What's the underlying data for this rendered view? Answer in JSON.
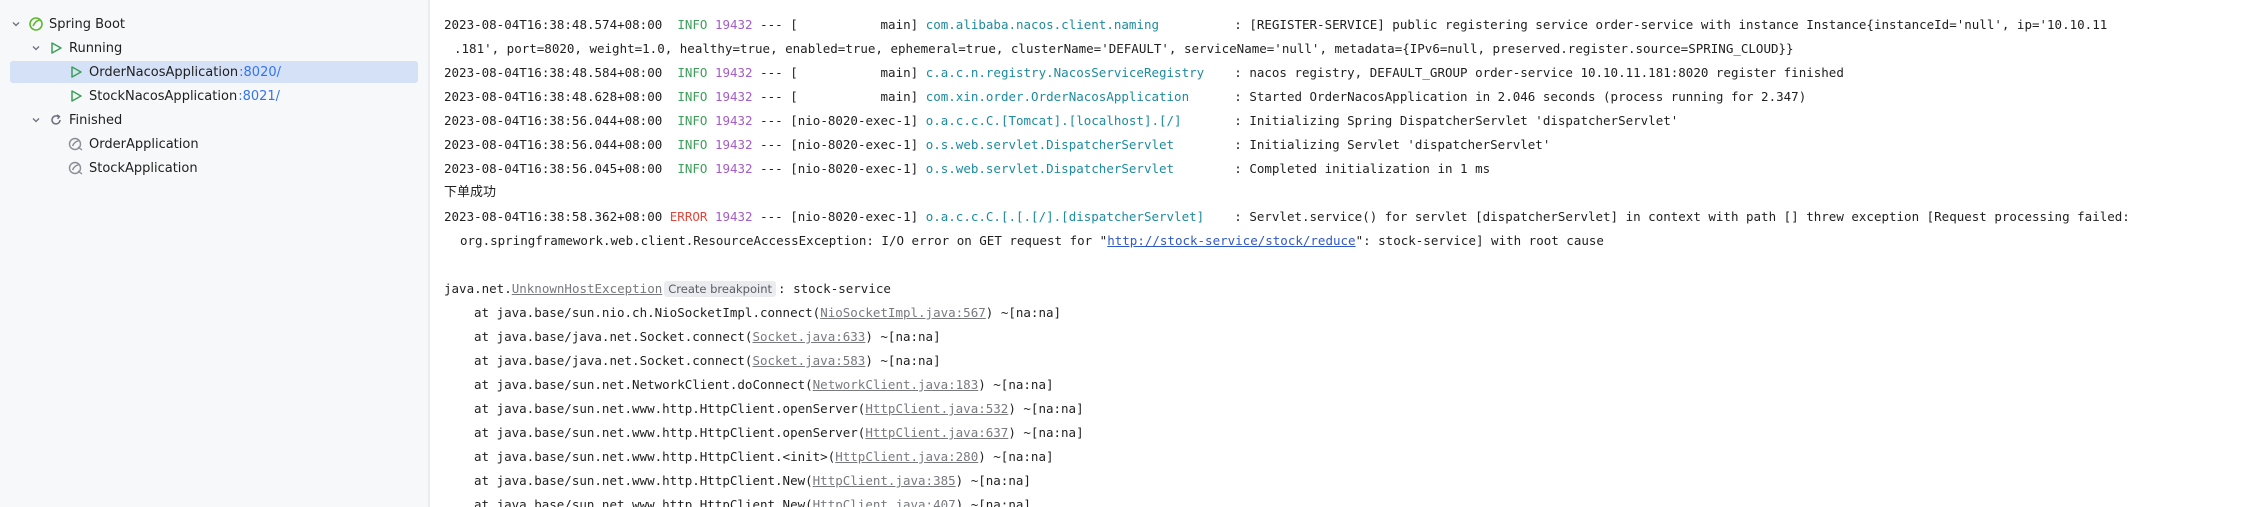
{
  "tree": {
    "root": {
      "label": "Spring Boot",
      "icon": "spring-boot-icon"
    },
    "running_group": {
      "label": "Running",
      "icon": "run-icon"
    },
    "running_items": [
      {
        "label": "OrderNacosApplication",
        "port": ":8020/",
        "icon": "run-icon",
        "selected": true
      },
      {
        "label": "StockNacosApplication",
        "port": ":8021/",
        "icon": "run-icon",
        "selected": false
      }
    ],
    "finished_group": {
      "label": "Finished",
      "icon": "rerun-icon"
    },
    "finished_items": [
      {
        "label": "OrderApplication",
        "icon": "spring-app-icon"
      },
      {
        "label": "StockApplication",
        "icon": "spring-app-icon"
      }
    ]
  },
  "console": {
    "log1": {
      "ts": "2023-08-04T16:38:48.574+08:00",
      "level": "INFO",
      "pid": "19432",
      "thread": "--- [           main]",
      "logger": "com.alibaba.nacos.client.naming",
      "msg": ": [REGISTER-SERVICE] public registering service order-service with instance Instance{instanceId='null', ip='10.10.11"
    },
    "log1_cont": ".181', port=8020, weight=1.0, healthy=true, enabled=true, ephemeral=true, clusterName='DEFAULT', serviceName='null', metadata={IPv6=null, preserved.register.source=SPRING_CLOUD}}",
    "log2": {
      "ts": "2023-08-04T16:38:48.584+08:00",
      "level": "INFO",
      "pid": "19432",
      "thread": "--- [           main]",
      "logger": "c.a.c.n.registry.NacosServiceRegistry",
      "msg": ": nacos registry, DEFAULT_GROUP order-service 10.10.11.181:8020 register finished"
    },
    "log3": {
      "ts": "2023-08-04T16:38:48.628+08:00",
      "level": "INFO",
      "pid": "19432",
      "thread": "--- [           main]",
      "logger": "com.xin.order.OrderNacosApplication",
      "msg": ": Started OrderNacosApplication in 2.046 seconds (process running for 2.347)"
    },
    "log4": {
      "ts": "2023-08-04T16:38:56.044+08:00",
      "level": "INFO",
      "pid": "19432",
      "thread": "--- [nio-8020-exec-1]",
      "logger": "o.a.c.c.C.[Tomcat].[localhost].[/]",
      "msg": ": Initializing Spring DispatcherServlet 'dispatcherServlet'"
    },
    "log5": {
      "ts": "2023-08-04T16:38:56.044+08:00",
      "level": "INFO",
      "pid": "19432",
      "thread": "--- [nio-8020-exec-1]",
      "logger": "o.s.web.servlet.DispatcherServlet",
      "msg": ": Initializing Servlet 'dispatcherServlet'"
    },
    "log6": {
      "ts": "2023-08-04T16:38:56.045+08:00",
      "level": "INFO",
      "pid": "19432",
      "thread": "--- [nio-8020-exec-1]",
      "logger": "o.s.web.servlet.DispatcherServlet",
      "msg": ": Completed initialization in 1 ms"
    },
    "stdout_line": "下单成功",
    "log7": {
      "ts": "2023-08-04T16:38:58.362+08:00",
      "level": "ERROR",
      "pid": "19432",
      "thread": "--- [nio-8020-exec-1]",
      "logger": "o.a.c.c.C.[.[.[/].[dispatcherServlet]",
      "msg": ": Servlet.service() for servlet [dispatcherServlet] in context with path [] threw exception [Request processing failed:"
    },
    "log7_cont_prefix": "org.springframework.web.client.ResourceAccessException: I/O error on GET request for \"",
    "log7_cont_url": "http://stock-service/stock/reduce",
    "log7_cont_suffix": "\": stock-service] with root cause",
    "exception": {
      "prefix": "java.net.",
      "class": "UnknownHostException",
      "breakpoint_label": "Create breakpoint",
      "suffix": ": stock-service"
    },
    "stack": [
      {
        "prefix": "at java.base/sun.nio.ch.NioSocketImpl.connect(",
        "src": "NioSocketImpl.java:567",
        "suffix": ") ~[na:na]"
      },
      {
        "prefix": "at java.base/java.net.Socket.connect(",
        "src": "Socket.java:633",
        "suffix": ") ~[na:na]"
      },
      {
        "prefix": "at java.base/java.net.Socket.connect(",
        "src": "Socket.java:583",
        "suffix": ") ~[na:na]"
      },
      {
        "prefix": "at java.base/sun.net.NetworkClient.doConnect(",
        "src": "NetworkClient.java:183",
        "suffix": ") ~[na:na]"
      },
      {
        "prefix": "at java.base/sun.net.www.http.HttpClient.openServer(",
        "src": "HttpClient.java:532",
        "suffix": ") ~[na:na]"
      },
      {
        "prefix": "at java.base/sun.net.www.http.HttpClient.openServer(",
        "src": "HttpClient.java:637",
        "suffix": ") ~[na:na]"
      },
      {
        "prefix": "at java.base/sun.net.www.http.HttpClient.<init>(",
        "src": "HttpClient.java:280",
        "suffix": ") ~[na:na]"
      },
      {
        "prefix": "at java.base/sun.net.www.http.HttpClient.New(",
        "src": "HttpClient.java:385",
        "suffix": ") ~[na:na]"
      },
      {
        "prefix": "at java.base/sun.net.www.http.HttpClient.New(",
        "src": "HttpClient.java:407",
        "suffix": ") ~[na:na]"
      }
    ]
  },
  "colors": {
    "info": "#3b9f58",
    "error": "#e0473a",
    "pid": "#a45cc7",
    "logger": "#1e8b9e",
    "selection": "#d5e1f7",
    "accent": "#3574f0"
  }
}
